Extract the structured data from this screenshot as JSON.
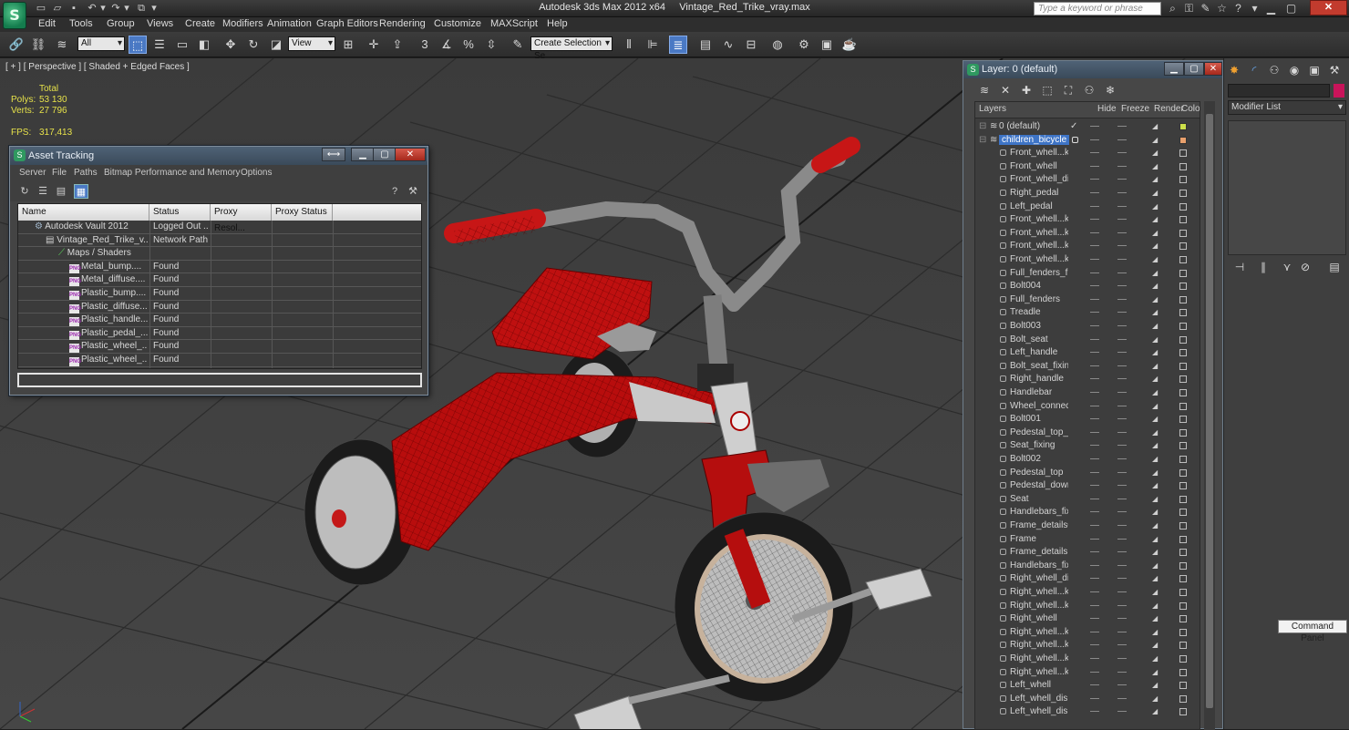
{
  "title_bar": {
    "app_title": "Autodesk 3ds Max  2012 x64",
    "file_name": "Vintage_Red_Trike_vray.max",
    "search_placeholder": "Type a keyword or phrase"
  },
  "menu": [
    "Edit",
    "Tools",
    "Group",
    "Views",
    "Create",
    "Modifiers",
    "Animation",
    "Graph Editors",
    "Rendering",
    "Customize",
    "MAXScript",
    "Help"
  ],
  "toolbar": {
    "selection_filter": "All",
    "reference_coord": "View",
    "named_selection": "Create Selection Se",
    "snap_label": "3",
    "angle_snap_label": "%"
  },
  "viewport": {
    "label": "[ + ] [ Perspective ] [ Shaded + Edged Faces ]",
    "stats": {
      "total_label": "Total",
      "polys_label": "Polys:",
      "polys": "53 130",
      "verts_label": "Verts:",
      "verts": "27 796",
      "fps_label": "FPS:",
      "fps": "317,413"
    }
  },
  "asset_tracking": {
    "title": "Asset Tracking",
    "menu": [
      "Server",
      "File",
      "Paths",
      "Bitmap Performance and Memory",
      "Options"
    ],
    "columns": [
      "Name",
      "Status",
      "Proxy Resol...",
      "Proxy Status"
    ],
    "rows": [
      {
        "name": "Autodesk Vault 2012",
        "status": "Logged Out ...",
        "icon": "vault-icon"
      },
      {
        "name": "Vintage_Red_Trike_v...",
        "status": "Network Path",
        "icon": "max-file-icon"
      },
      {
        "name": "Maps / Shaders",
        "status": "",
        "icon": "maps-icon"
      },
      {
        "name": "Metal_bump....",
        "status": "Found",
        "icon": "png-icon"
      },
      {
        "name": "Metal_diffuse....",
        "status": "Found",
        "icon": "png-icon"
      },
      {
        "name": "Plastic_bump....",
        "status": "Found",
        "icon": "png-icon"
      },
      {
        "name": "Plastic_diffuse....",
        "status": "Found",
        "icon": "png-icon"
      },
      {
        "name": "Plastic_handle....",
        "status": "Found",
        "icon": "png-icon"
      },
      {
        "name": "Plastic_pedal_....",
        "status": "Found",
        "icon": "png-icon"
      },
      {
        "name": "Plastic_wheel_....",
        "status": "Found",
        "icon": "png-icon"
      },
      {
        "name": "Plastic_wheel_....",
        "status": "Found",
        "icon": "png-icon"
      }
    ],
    "png_label": "PNG"
  },
  "layer_manager": {
    "title": "Layer: 0 (default)",
    "columns": {
      "layers": "Layers",
      "hide": "Hide",
      "freeze": "Freeze",
      "render": "Render",
      "color": "Color"
    },
    "layers": [
      {
        "name": "0 (default)",
        "color": "#cde04a",
        "current": true
      },
      {
        "name": "children_bicycle",
        "color": "#e9a06c",
        "selected": true
      }
    ],
    "objects": [
      "Front_whell...k_",
      "Front_whell",
      "Front_whell_disk",
      "Right_pedal",
      "Left_pedal",
      "Front_whell...k_",
      "Front_whell...k_",
      "Front_whell...k_",
      "Front_whell...k_",
      "Full_fenders_fixi",
      "Bolt004",
      "Full_fenders",
      "Treadle",
      "Bolt003",
      "Bolt_seat",
      "Left_handle",
      "Bolt_seat_fixing",
      "Right_handle",
      "Handlebar",
      "Wheel_connecto",
      "Bolt001",
      "Pedestal_top_fix",
      "Seat_fixing",
      "Bolt002",
      "Pedestal_top",
      "Pedestal_down",
      "Seat",
      "Handlebars_fixin",
      "Frame_details00",
      "Frame",
      "Frame_details",
      "Handlebars_fixin",
      "Right_whell_disk",
      "Right_whell...k_",
      "Right_whell...k_",
      "Right_whell",
      "Right_whell...k_",
      "Right_whell...k_",
      "Right_whell...k_",
      "Right_whell...k_",
      "Left_whell",
      "Left_whell_disk_",
      "Left_whell_disk"
    ]
  },
  "command_panel": {
    "modifier_list": "Modifier List",
    "name_color": "#c8145a",
    "tooltip": "Command Panel"
  },
  "accent_color": "#4a79c4"
}
